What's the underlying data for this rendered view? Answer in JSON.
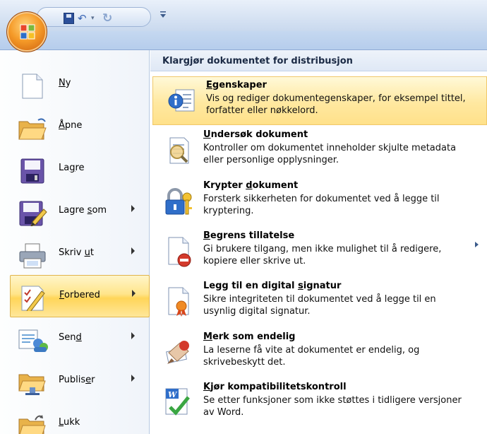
{
  "qat": {
    "customize_glyph": "₹"
  },
  "left_menu": [
    {
      "id": "ny",
      "pre": "",
      "key": "N",
      "post": "y",
      "icon": "new-document-icon",
      "arrow": false,
      "active": false
    },
    {
      "id": "apne",
      "pre": "",
      "key": "Å",
      "post": "pne",
      "icon": "open-folder-icon",
      "arrow": false,
      "active": false
    },
    {
      "id": "lagre",
      "pre": "La",
      "key": "g",
      "post": "re",
      "icon": "save-floppy-icon",
      "arrow": false,
      "active": false
    },
    {
      "id": "lagre-som",
      "pre": "Lagre ",
      "key": "s",
      "post": "om",
      "icon": "save-as-icon",
      "arrow": true,
      "active": false
    },
    {
      "id": "skriv-ut",
      "pre": "Skriv ",
      "key": "u",
      "post": "t",
      "icon": "printer-icon",
      "arrow": true,
      "active": false
    },
    {
      "id": "forbered",
      "pre": "",
      "key": "F",
      "post": "orbered",
      "icon": "prepare-icon",
      "arrow": true,
      "active": true
    },
    {
      "id": "send",
      "pre": "Sen",
      "key": "d",
      "post": "",
      "icon": "send-icon",
      "arrow": true,
      "active": false
    },
    {
      "id": "publiser",
      "pre": "Publis",
      "key": "e",
      "post": "r",
      "icon": "publish-icon",
      "arrow": true,
      "active": false
    },
    {
      "id": "lukk",
      "pre": "",
      "key": "L",
      "post": "ukk",
      "icon": "close-folder-icon",
      "arrow": false,
      "active": false
    }
  ],
  "panel": {
    "title": "Klargjør dokumentet for distribusjon",
    "options": [
      {
        "id": "egenskaper",
        "t_pre": "",
        "t_key": "E",
        "t_post": "genskaper",
        "desc": "Vis og rediger dokumentegenskaper, for eksempel tittel, forfatter eller nøkkelord.",
        "icon": "properties-icon",
        "active": true,
        "arrow": false
      },
      {
        "id": "undersok",
        "t_pre": "",
        "t_key": "U",
        "t_post": "ndersøk dokument",
        "desc": "Kontroller om dokumentet inneholder skjulte metadata eller personlige opplysninger.",
        "icon": "inspect-document-icon",
        "active": false,
        "arrow": false
      },
      {
        "id": "krypter",
        "t_pre": "Krypter ",
        "t_key": "d",
        "t_post": "okument",
        "desc": "Forsterk sikkerheten for dokumentet ved å legge til kryptering.",
        "icon": "encrypt-lock-key-icon",
        "active": false,
        "arrow": false
      },
      {
        "id": "begrens",
        "t_pre": "",
        "t_key": "B",
        "t_post": "egrens tillatelse",
        "desc": "Gi brukere tilgang, men ikke mulighet til å redigere, kopiere eller skrive ut.",
        "icon": "restrict-permission-icon",
        "active": false,
        "arrow": true
      },
      {
        "id": "signatur",
        "t_pre": "Legg til en digital ",
        "t_key": "s",
        "t_post": "ignatur",
        "desc": "Sikre integriteten til dokumentet ved å legge til en usynlig digital signatur.",
        "icon": "digital-signature-icon",
        "active": false,
        "arrow": false
      },
      {
        "id": "endelig",
        "t_pre": "",
        "t_key": "M",
        "t_post": "erk som endelig",
        "desc": "La leserne få vite at dokumentet er endelig, og skrivebeskytt det.",
        "icon": "mark-final-icon",
        "active": false,
        "arrow": false
      },
      {
        "id": "kompatibilitet",
        "t_pre": "",
        "t_key": "K",
        "t_post": "jør kompatibilitetskontroll",
        "desc": "Se etter funksjoner som ikke støttes i tidligere versjoner av Word.",
        "icon": "compatibility-check-icon",
        "active": false,
        "arrow": false
      }
    ]
  }
}
